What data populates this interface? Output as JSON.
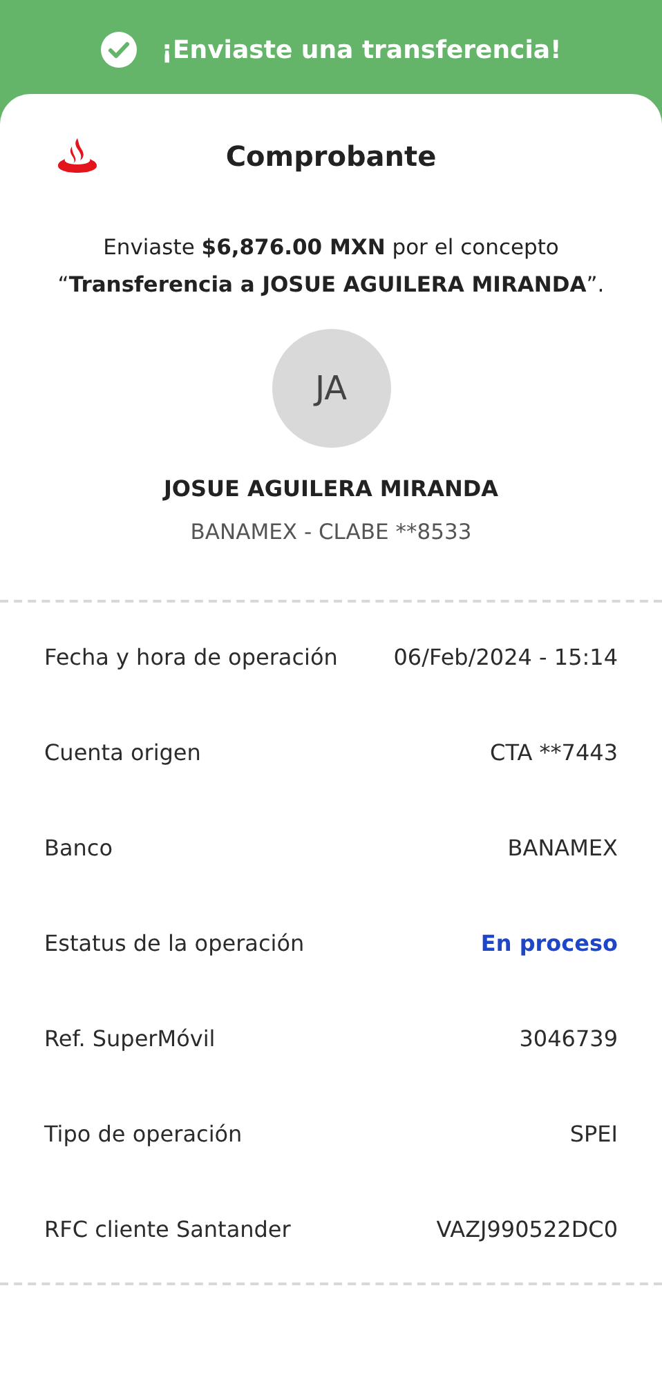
{
  "banner": {
    "title": "¡Enviaste una transferencia!"
  },
  "receipt": {
    "title": "Comprobante",
    "message": "Enviaste **$6,876.00 MXN** por el concepto “**Transferencia a JOSUE AGUILERA MIRANDA**”.",
    "recipient": {
      "initials": "JA",
      "name": "JOSUE AGUILERA MIRANDA",
      "account": "BANAMEX - CLABE **8533"
    }
  },
  "details": [
    {
      "kind": "plain",
      "label": "Fecha y hora de operación",
      "value": "06/Feb/2024 - 15:14"
    },
    {
      "kind": "plain",
      "label": "Cuenta origen",
      "value": "CTA **7443"
    },
    {
      "kind": "plain",
      "label": "Banco",
      "value": "BANAMEX"
    },
    {
      "kind": "status",
      "label": "Estatus de la operación",
      "value": "En proceso"
    },
    {
      "kind": "plain",
      "label": "Ref. SuperMóvil",
      "value": "3046739"
    },
    {
      "kind": "plain",
      "label": "Tipo de operación",
      "value": "SPEI"
    },
    {
      "kind": "plain",
      "label": "RFC cliente Santander",
      "value": "VAZJ990522DC0"
    }
  ]
}
